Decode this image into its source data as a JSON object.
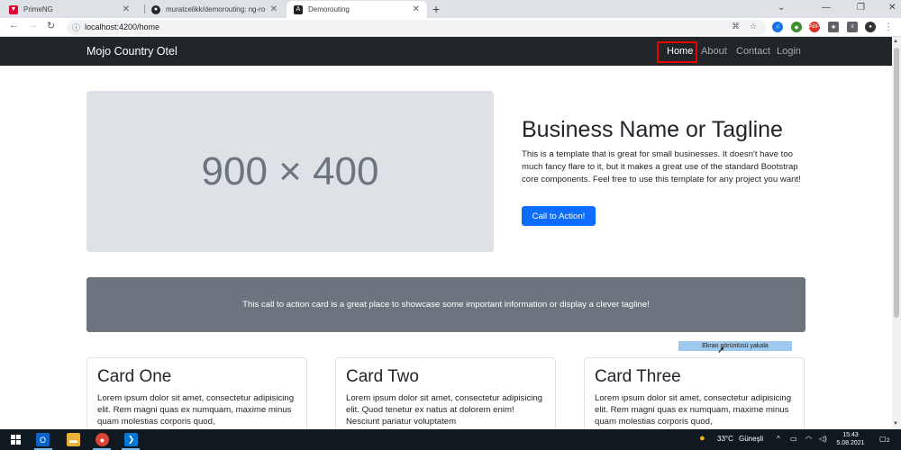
{
  "browser": {
    "tabs": [
      {
        "title": "PrimeNG",
        "icon": "primeng-icon"
      },
      {
        "title": "muratcelikk/demorouting: ng-ro",
        "icon": "github-icon"
      },
      {
        "title": "Demorouting",
        "icon": "angular-icon"
      }
    ],
    "url": "localhost:4200/home"
  },
  "navbar": {
    "brand": "Mojo Country Otel",
    "links": [
      "Home",
      "About",
      "Contact",
      "Login"
    ]
  },
  "hero": {
    "placeholder": "900 × 400",
    "title": "Business Name or Tagline",
    "text": "This is a template that is great for small businesses. It doesn't have too much fancy flare to it, but it makes a great use of the standard Bootstrap core components. Feel free to use this template for any project you want!",
    "button": "Call to Action!"
  },
  "cta_card": {
    "text": "This call to action card is a great place to showcase some important information or display a clever tagline!"
  },
  "snip_tooltip": "Ekran görüntüsü yakala",
  "cards": [
    {
      "title": "Card One",
      "text": "Lorem ipsum dolor sit amet, consectetur adipisicing elit. Rem magni quas ex numquam, maxime minus quam molestias corporis quod,"
    },
    {
      "title": "Card Two",
      "text": "Lorem ipsum dolor sit amet, consectetur adipisicing elit. Quod tenetur ex natus at dolorem enim! Nesciunt pariatur voluptatem"
    },
    {
      "title": "Card Three",
      "text": "Lorem ipsum dolor sit amet, consectetur adipisicing elit. Rem magni quas ex numquam, maxime minus quam molestias corporis quod,"
    }
  ],
  "taskbar": {
    "weather": "33°C",
    "weather_desc": "Güneşli",
    "time": "15:43",
    "date": "5.08.2021",
    "notifications": "2"
  },
  "colors": {
    "navbar_bg": "#212529",
    "primary": "#0d6efd",
    "cta_bg": "#6c757d",
    "placeholder_bg": "#dee2e6",
    "highlight_border": "#e00000"
  }
}
